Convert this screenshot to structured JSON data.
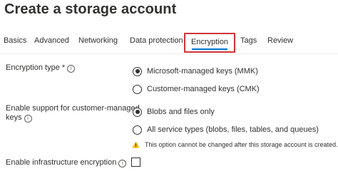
{
  "page": {
    "title": "Create a storage account",
    "more_label": "···"
  },
  "tabs": [
    {
      "label": "Basics",
      "active": false
    },
    {
      "label": "Advanced",
      "active": false
    },
    {
      "label": "Networking",
      "active": false
    },
    {
      "label": "Data protection",
      "active": false
    },
    {
      "label": "Encryption",
      "active": true
    },
    {
      "label": "Tags",
      "active": false
    },
    {
      "label": "Review",
      "active": false
    }
  ],
  "encryption_type": {
    "label": "Encryption type *",
    "info_icon": "info-icon",
    "options": [
      {
        "label": "Microsoft-managed keys (MMK)",
        "selected": true
      },
      {
        "label": "Customer-managed keys (CMK)",
        "selected": false
      }
    ]
  },
  "cmk_support": {
    "label_line1": "Enable support for customer-managed",
    "label_line2": "keys",
    "info_icon": "info-icon",
    "options": [
      {
        "label": "Blobs and files only",
        "selected": true
      },
      {
        "label": "All service types (blobs, files, tables, and queues)",
        "selected": false
      }
    ],
    "warning_icon": "warning-triangle-icon",
    "warning_text": "This option cannot be changed after this storage account is created."
  },
  "infrastructure_encryption": {
    "label": "Enable infrastructure encryption",
    "info_icon": "info-icon",
    "checked": false
  },
  "colors": {
    "active_tab_underline": "#0078d4",
    "highlight_box": "#d13438",
    "warning": "#f2b600",
    "text": "#323130"
  }
}
